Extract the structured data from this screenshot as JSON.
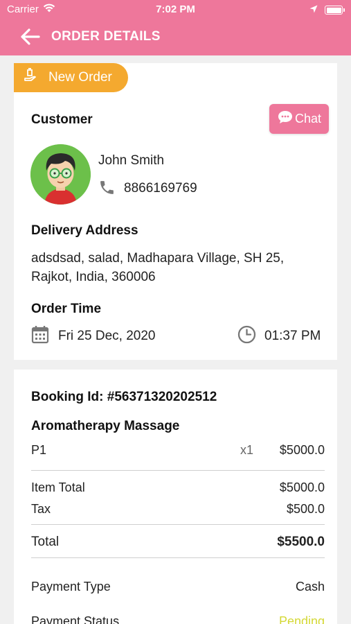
{
  "status_bar": {
    "carrier": "Carrier",
    "time": "7:02 PM"
  },
  "header": {
    "title": "ORDER DETAILS"
  },
  "order": {
    "badge": "New Order",
    "chat_label": "Chat",
    "customer_label": "Customer",
    "customer_name": "John Smith",
    "phone": "8866169769",
    "delivery_label": "Delivery Address",
    "address_line1": "adsdsad, salad, Madhapara Village, SH 25,",
    "address_line2": "Rajkot, India, 360006",
    "time_label": "Order Time",
    "date": "Fri 25 Dec, 2020",
    "time": "01:37 PM"
  },
  "booking": {
    "booking_id": "Booking Id: #56371320202512",
    "service_name": "Aromatherapy Massage",
    "item": {
      "name": "P1",
      "qty": "x1",
      "price": "$5000.0"
    },
    "item_total_label": "Item Total",
    "item_total": "$5000.0",
    "tax_label": "Tax",
    "tax": "$500.0",
    "total_label": "Total",
    "total": "$5500.0",
    "payment_type_label": "Payment Type",
    "payment_type": "Cash",
    "payment_status_label": "Payment Status",
    "payment_status": "Pending"
  },
  "colors": {
    "primary": "#ee779b",
    "badge": "#f4a92f",
    "pending": "#d4d836"
  },
  "icons": [
    "wifi-icon",
    "location-arrow-icon",
    "battery-icon",
    "back-arrow-icon",
    "hand-bell-icon",
    "chat-bubble-icon",
    "phone-icon",
    "calendar-icon",
    "clock-icon"
  ]
}
